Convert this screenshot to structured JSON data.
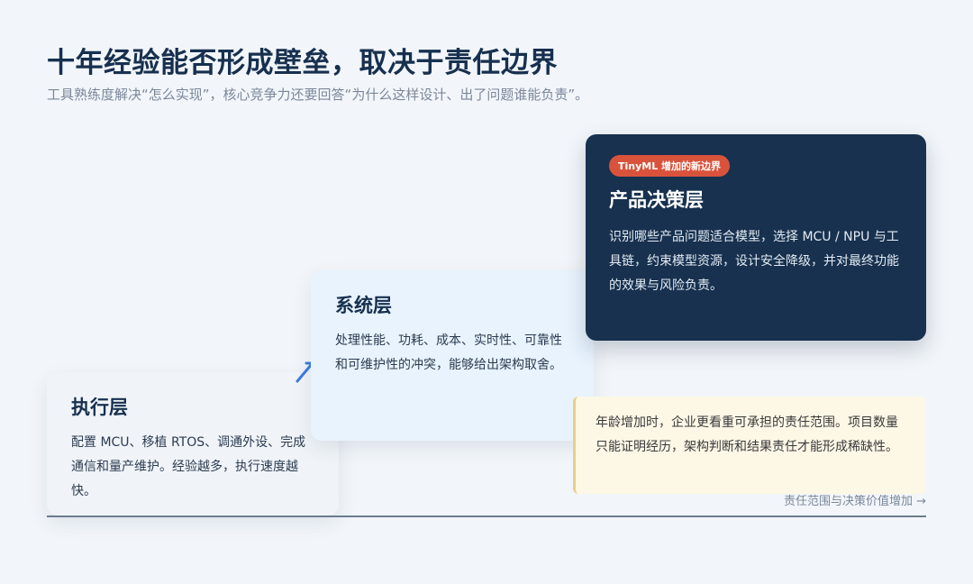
{
  "header": {
    "title": "十年经验能否形成壁垒，取决于责任边界",
    "subtitle": "工具熟练度解决“怎么实现”，核心竞争力还要回答“为什么这样设计、出了问题谁能负责”。"
  },
  "layers": {
    "execution": {
      "title": "执行层",
      "description": "配置 MCU、移植 RTOS、调通外设、完成通信和量产维护。经验越多，执行速度越快。"
    },
    "system": {
      "title": "系统层",
      "description": "处理性能、功耗、成本、实时性、可靠性和可维护性的冲突，能够给出架构取舍。"
    },
    "product": {
      "badge": "TinyML 增加的新边界",
      "title": "产品决策层",
      "description": "识别哪些产品问题适合模型，选择 MCU / NPU 与工具链，约束模型资源，设计安全降级，并对最终功能的效果与风险负责。"
    }
  },
  "note": {
    "text": "年龄增加时，企业更看重可承担的责任范围。项目数量只能证明经历，架构判断和结果责任才能形成稀缺性。"
  },
  "axis": {
    "label": "责任范围与决策价值增加 →"
  },
  "colors": {
    "background": "#f2f6fa",
    "title": "#17304f",
    "product_card": "#17314f",
    "system_card": "#e8f3fd",
    "execution_card": "#f0f4f8",
    "badge": "#d9533c",
    "note_bg": "#fdf7e6",
    "note_border": "#e9cf8a",
    "arrow": "#3d7be0"
  },
  "icons": {
    "step_arrow": "arrow-up-right-icon"
  }
}
